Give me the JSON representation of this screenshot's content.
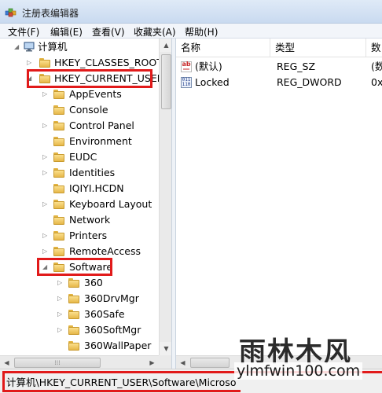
{
  "window": {
    "title": "注册表编辑器",
    "app_icon": "regedit-icon"
  },
  "menu": [
    "文件(F)",
    "编辑(E)",
    "查看(V)",
    "收藏夹(A)",
    "帮助(H)"
  ],
  "tree": {
    "root": "计算机",
    "hives": [
      "HKEY_CLASSES_ROOT",
      "HKEY_CURRENT_USER"
    ],
    "hkcu_children": [
      "AppEvents",
      "Console",
      "Control Panel",
      "Environment",
      "EUDC",
      "Identities",
      "IQIYI.HCDN",
      "Keyboard Layout",
      "Network",
      "Printers",
      "RemoteAccess",
      "Software"
    ],
    "software_children": [
      "360",
      "360DrvMgr",
      "360Safe",
      "360SoftMgr",
      "360WallPaper"
    ]
  },
  "list": {
    "columns": [
      "名称",
      "类型",
      "数"
    ],
    "rows": [
      {
        "name": "(默认)",
        "type": "REG_SZ",
        "data": "(数",
        "icon": "string-value-icon"
      },
      {
        "name": "Locked",
        "type": "REG_DWORD",
        "data": "0x",
        "icon": "binary-value-icon"
      }
    ]
  },
  "status": {
    "path": "计算机\\HKEY_CURRENT_USER\\Software\\Microso"
  },
  "watermark": {
    "title": "雨林木风",
    "url": "ylmfwin100.com"
  },
  "colors": {
    "highlight": "#e11a1a",
    "folder": "#e6b84a"
  }
}
